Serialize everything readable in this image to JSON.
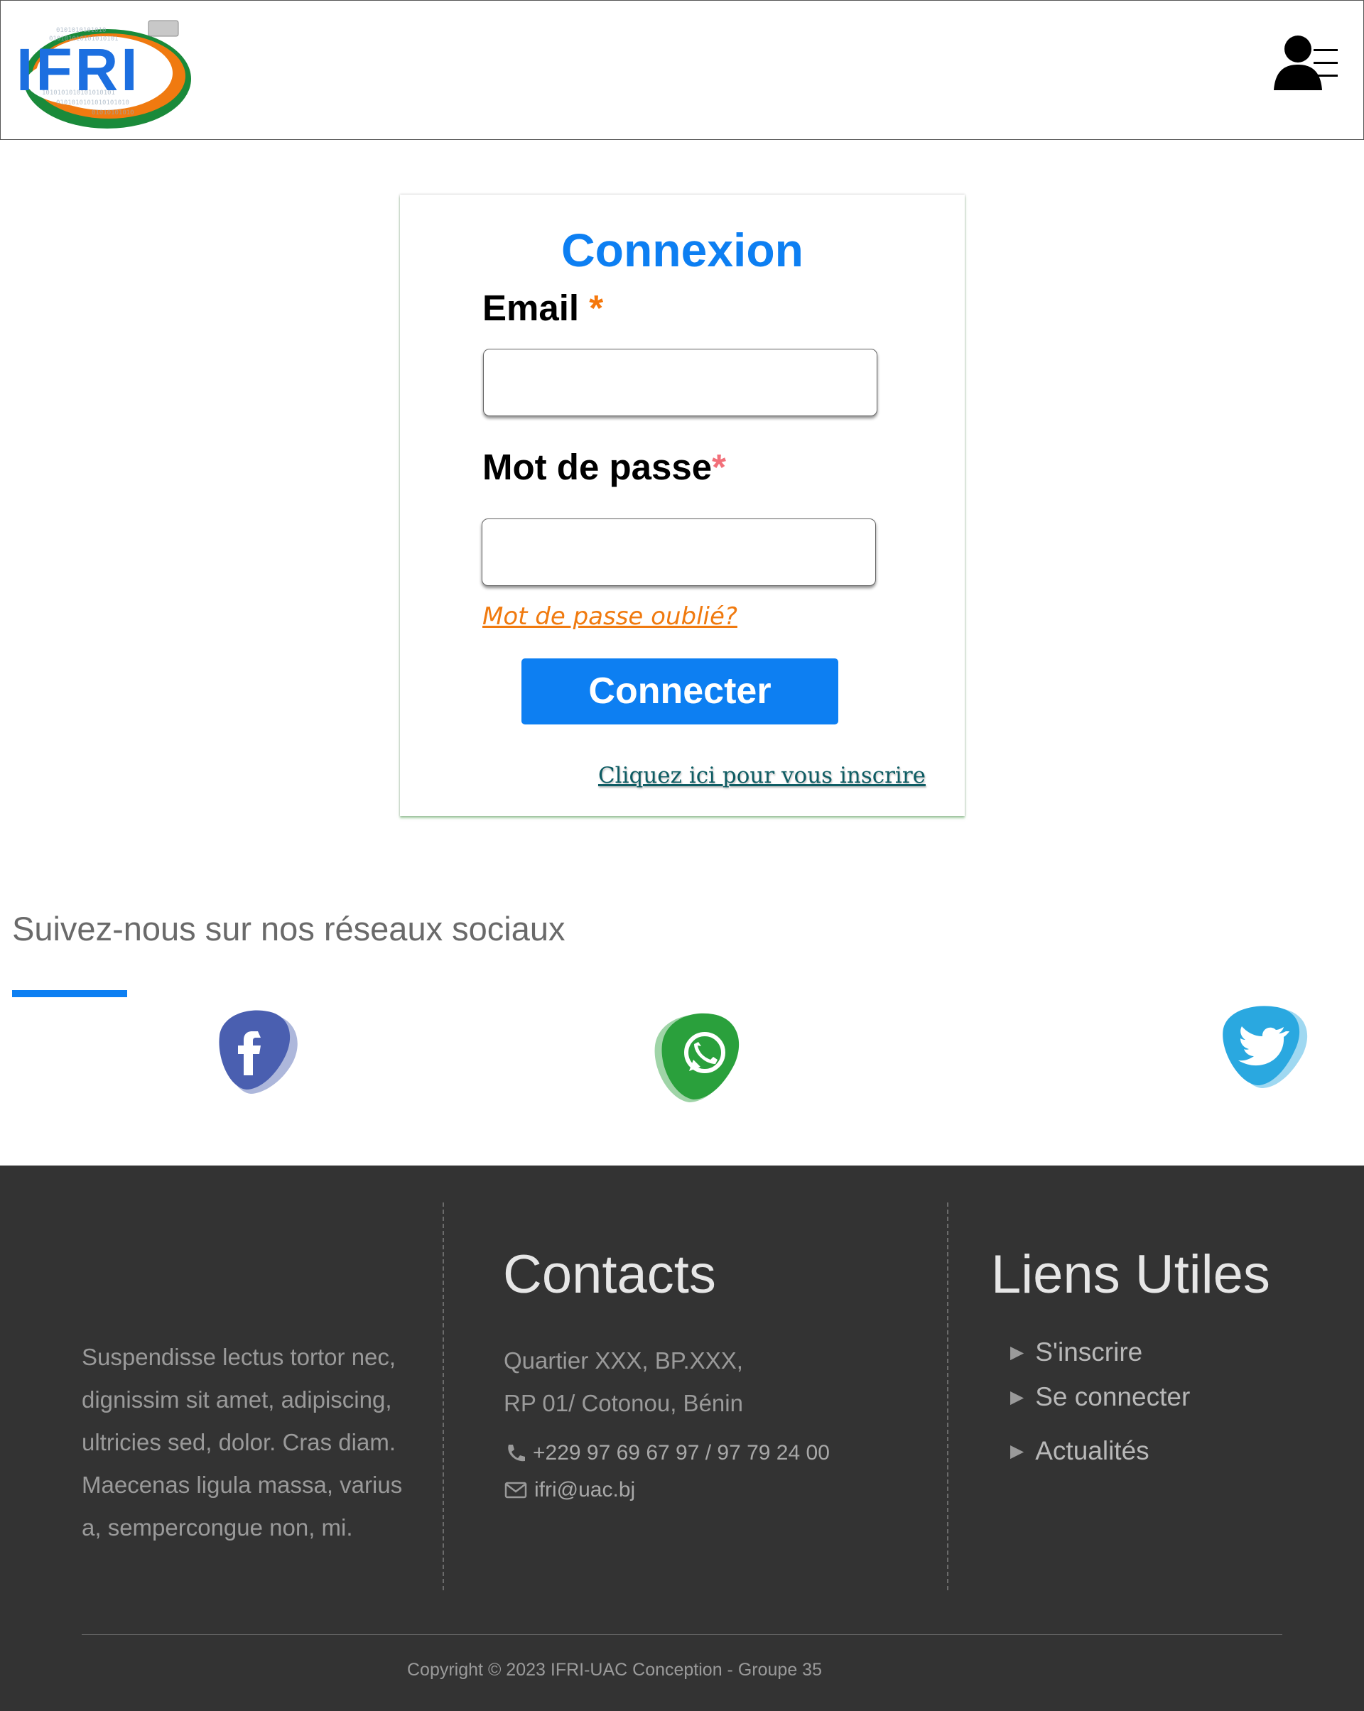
{
  "header": {
    "logo_text": "IFRI",
    "user_menu_icon": "user-menu-icon"
  },
  "login": {
    "title": "Connexion",
    "email_label": "Email",
    "email_required": "*",
    "email_value": "",
    "password_label": "Mot de passe",
    "password_required": "*",
    "password_value": "",
    "forgot_link": "Mot de passe oublié?",
    "submit_label": "Connecter",
    "signup_link": "Cliquez ici pour vous inscrire"
  },
  "social": {
    "title": "Suivez-nous sur nos réseaux sociaux",
    "icons": [
      "facebook-icon",
      "whatsapp-icon",
      "twitter-icon"
    ]
  },
  "footer": {
    "about": "Suspendisse lectus tortor nec, dignissim sit amet, adipiscing, ultricies sed, dolor. Cras diam. Maecenas ligula massa, varius a, sempercongue non, mi.",
    "contacts_heading": "Contacts",
    "address_line1": "Quartier XXX, BP.XXX,",
    "address_line2": "RP 01/ Cotonou, Bénin",
    "phone": "+229 97 69 67 97 / 97 79 24 00",
    "email": "ifri@uac.bj",
    "links_heading": "Liens Utiles",
    "links": [
      "S'inscrire",
      "Se connecter",
      "Actualités"
    ],
    "copyright": "Copyright © 2023 IFRI-UAC Conception - Groupe 35"
  },
  "colors": {
    "accent": "#0d7ff2",
    "required": "#f5770b",
    "footer_bg": "#333333",
    "facebook": "#4a5fb0",
    "whatsapp": "#2aa03c",
    "twitter": "#2aa8e0"
  }
}
